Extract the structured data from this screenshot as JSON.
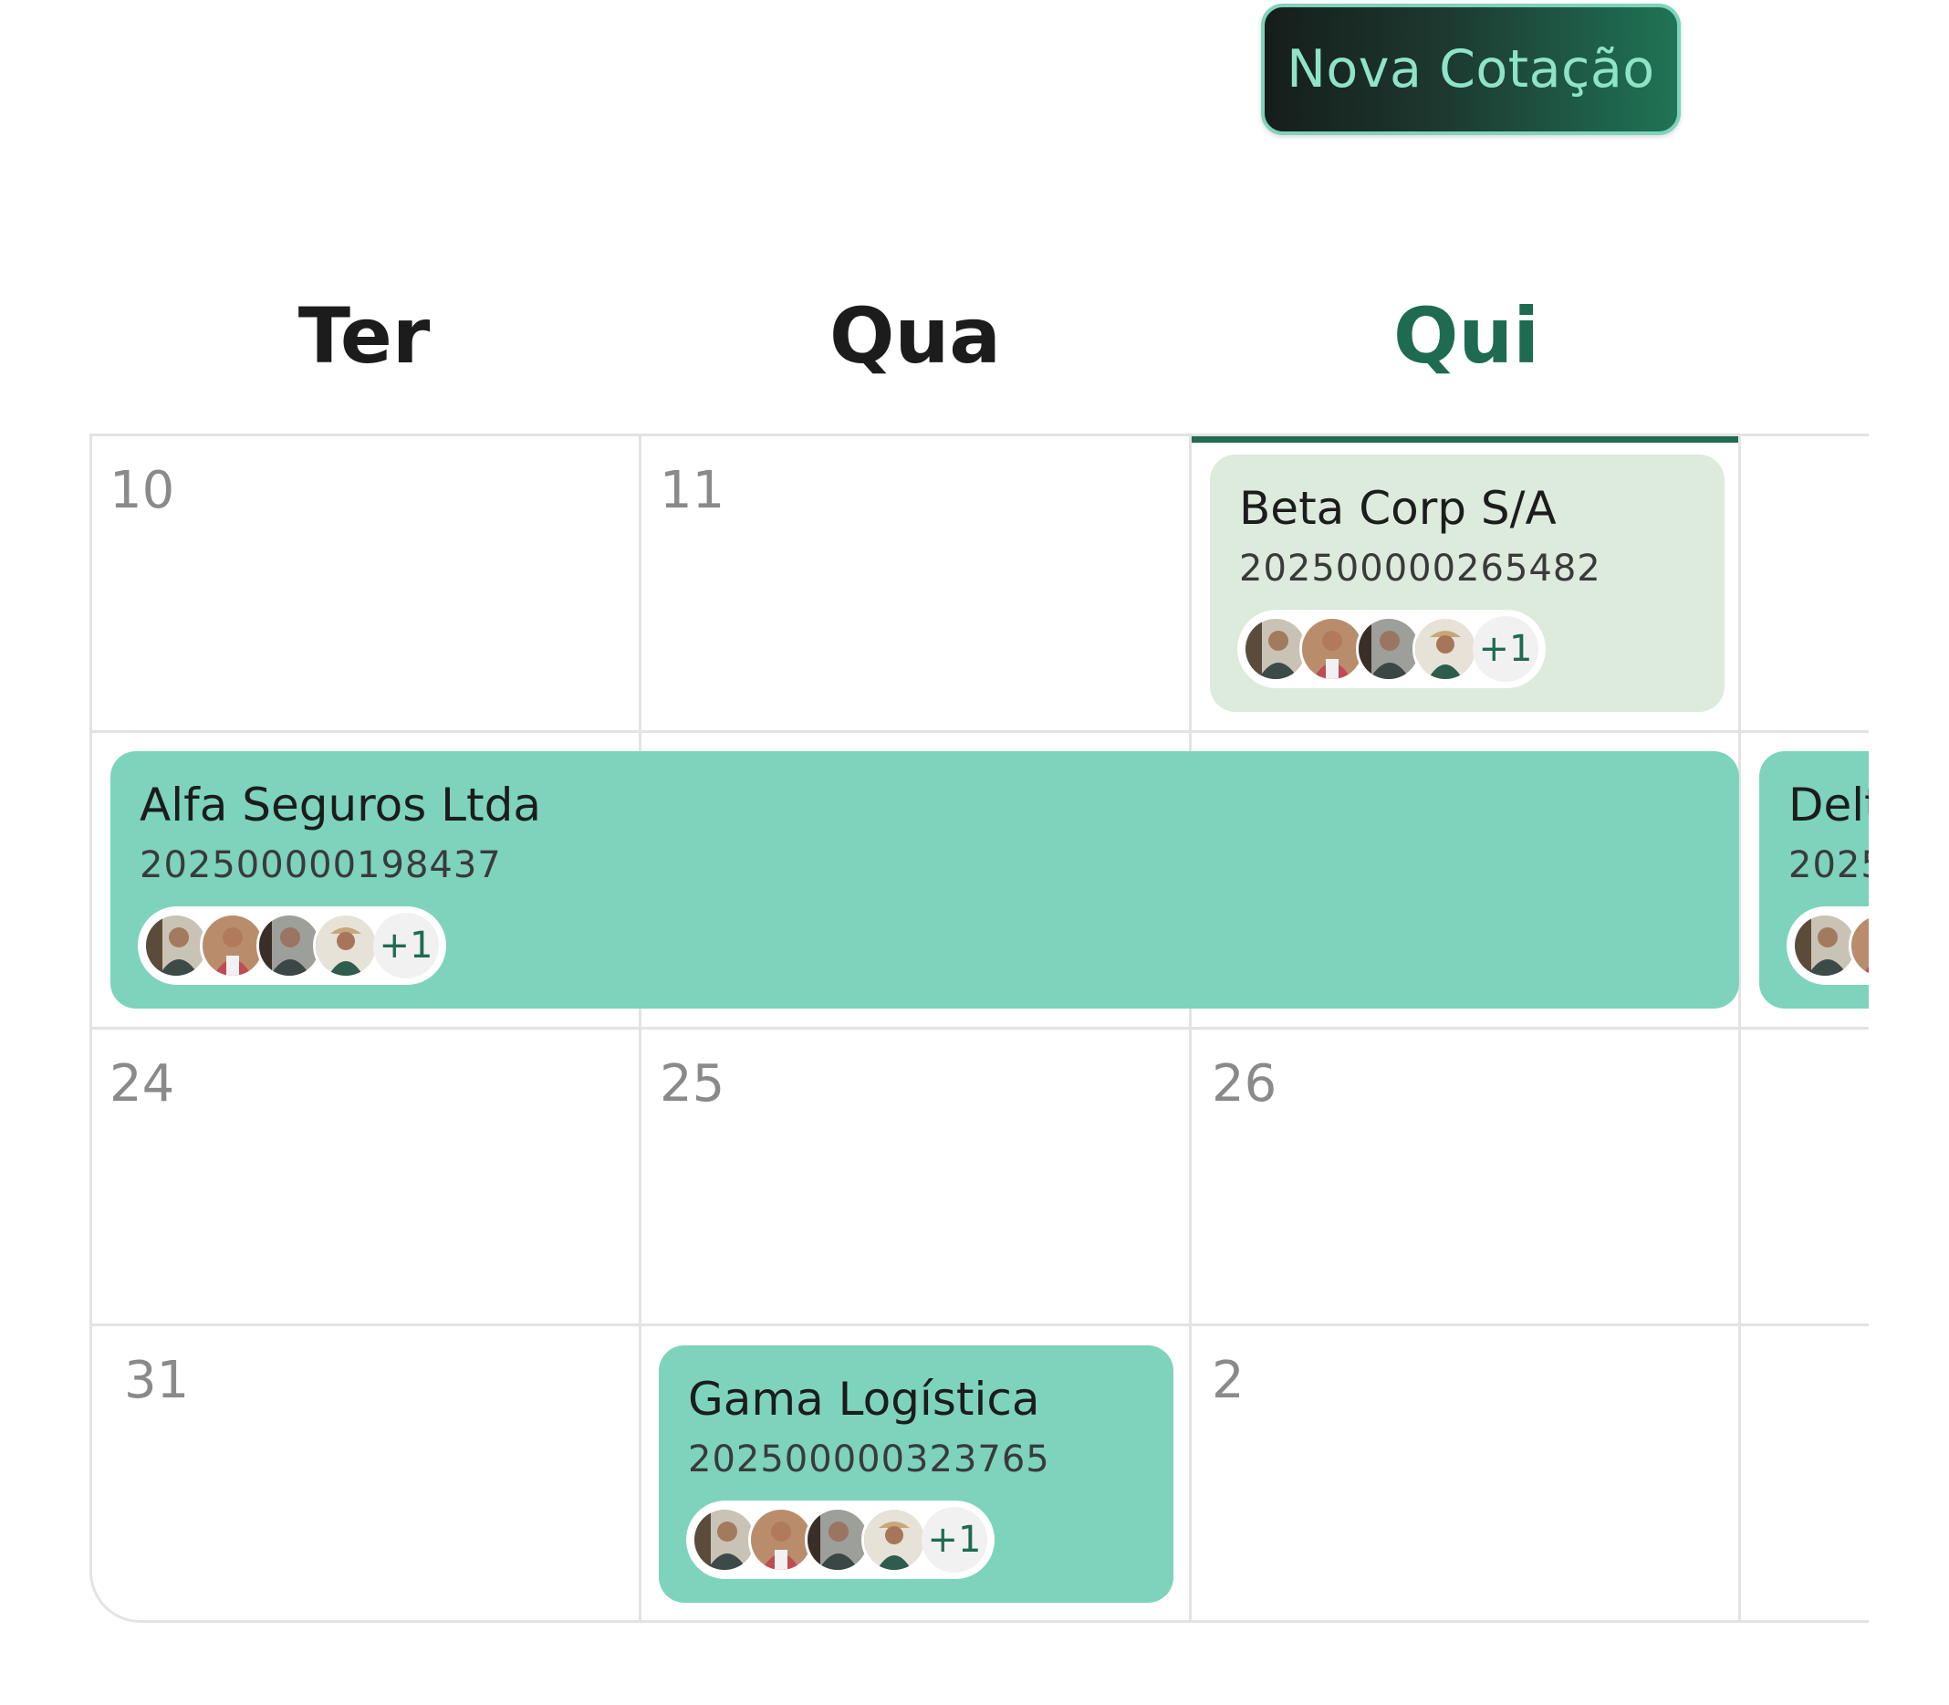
{
  "toolbar": {
    "new_quote_label": "Nova Cotação"
  },
  "weekdays": [
    {
      "label": "Ter",
      "active": false
    },
    {
      "label": "Qua",
      "active": false
    },
    {
      "label": "Qui",
      "active": true
    }
  ],
  "weeks": [
    {
      "days": [
        "10",
        "11",
        ""
      ]
    },
    {
      "days": [
        "",
        "",
        ""
      ]
    },
    {
      "days": [
        "24",
        "25",
        "26"
      ]
    },
    {
      "days": [
        "31",
        "",
        "2"
      ]
    }
  ],
  "events": [
    {
      "title": "Beta Corp S/A",
      "id": "202500000265482",
      "extra_count": "+1",
      "style": "light"
    },
    {
      "title": "Alfa Seguros Ltda",
      "id": "202500000198437",
      "extra_count": "+1",
      "style": "teal"
    },
    {
      "title": "Delt",
      "id": "2025",
      "extra_count": "",
      "style": "teal"
    },
    {
      "title": "Gama Logística",
      "id": "202500000323765",
      "extra_count": "+1",
      "style": "teal"
    }
  ],
  "colors": {
    "accent": "#1f6b51",
    "event_teal": "#7ed3bc",
    "event_light": "#dcebdc",
    "grid_line": "#e3e3e6"
  }
}
